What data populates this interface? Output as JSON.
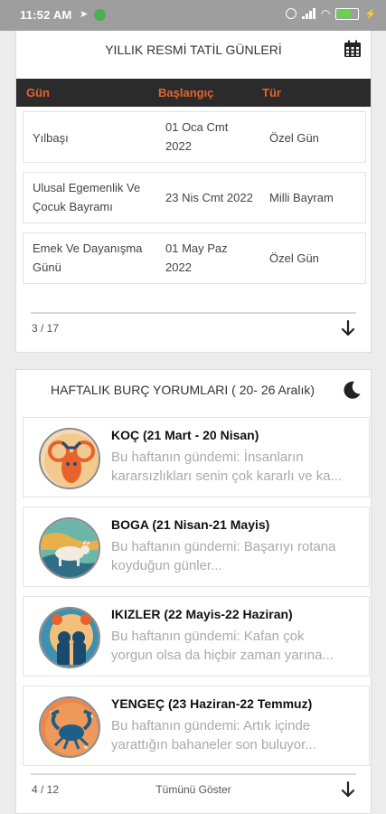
{
  "status_bar": {
    "time": "11:52 AM"
  },
  "holidays": {
    "title": "YILLIK RESMİ TATİL GÜNLERİ",
    "columns": [
      "Gün",
      "Başlangıç",
      "Tür"
    ],
    "rows": [
      {
        "name_line1": "Yılbaşı",
        "name_line2": "",
        "date_line1": "01 Oca Cmt",
        "date_line2": "2022",
        "type": "Özel Gün"
      },
      {
        "name_line1": "Ulusal Egemenlik Ve",
        "name_line2": "Çocuk Bayramı",
        "date_line1": "23 Nis Cmt 2022",
        "date_line2": "",
        "type": "Milli Bayram"
      },
      {
        "name_line1": "Emek Ve Dayanışma",
        "name_line2": "Günü",
        "date_line1": "01 May Paz",
        "date_line2": "2022",
        "type": "Özel Gün"
      }
    ],
    "pager": "3 / 17"
  },
  "horoscopes": {
    "title": "HAFTALIK BURÇ YORUMLARI ( 20- 26 Aralık)",
    "items": [
      {
        "name": "KOÇ (21 Mart - 20 Nisan)",
        "line1": "Bu haftanın gündemi: İnsanların",
        "line2": "kararsızlıkları senin çok kararlı ve ka..."
      },
      {
        "name": "BOGA (21 Nisan-21 Mayis)",
        "line1": "Bu haftanın gündemi: Başarıyı rotana",
        "line2": "koyduğun günler..."
      },
      {
        "name": "IKIZLER (22 Mayis-22 Haziran)",
        "line1": "Bu haftanın gündemi: Kafan çok",
        "line2": "yorgun olsa da hiçbir zaman yarına..."
      },
      {
        "name": "YENGEÇ (23 Haziran-22 Temmuz)",
        "line1": "Bu haftanın gündemi: Artık içinde",
        "line2": "yarattığın bahaneler son buluyor..."
      }
    ],
    "pager": "4 / 12",
    "show_all": "Tümünü Göster"
  },
  "icons": {
    "calendar": "calendar-icon",
    "moon": "moon-icon",
    "arrow": "arrow-down-icon"
  },
  "colors": {
    "accent": "#e8632b",
    "header_bg": "#2b2b2b"
  }
}
